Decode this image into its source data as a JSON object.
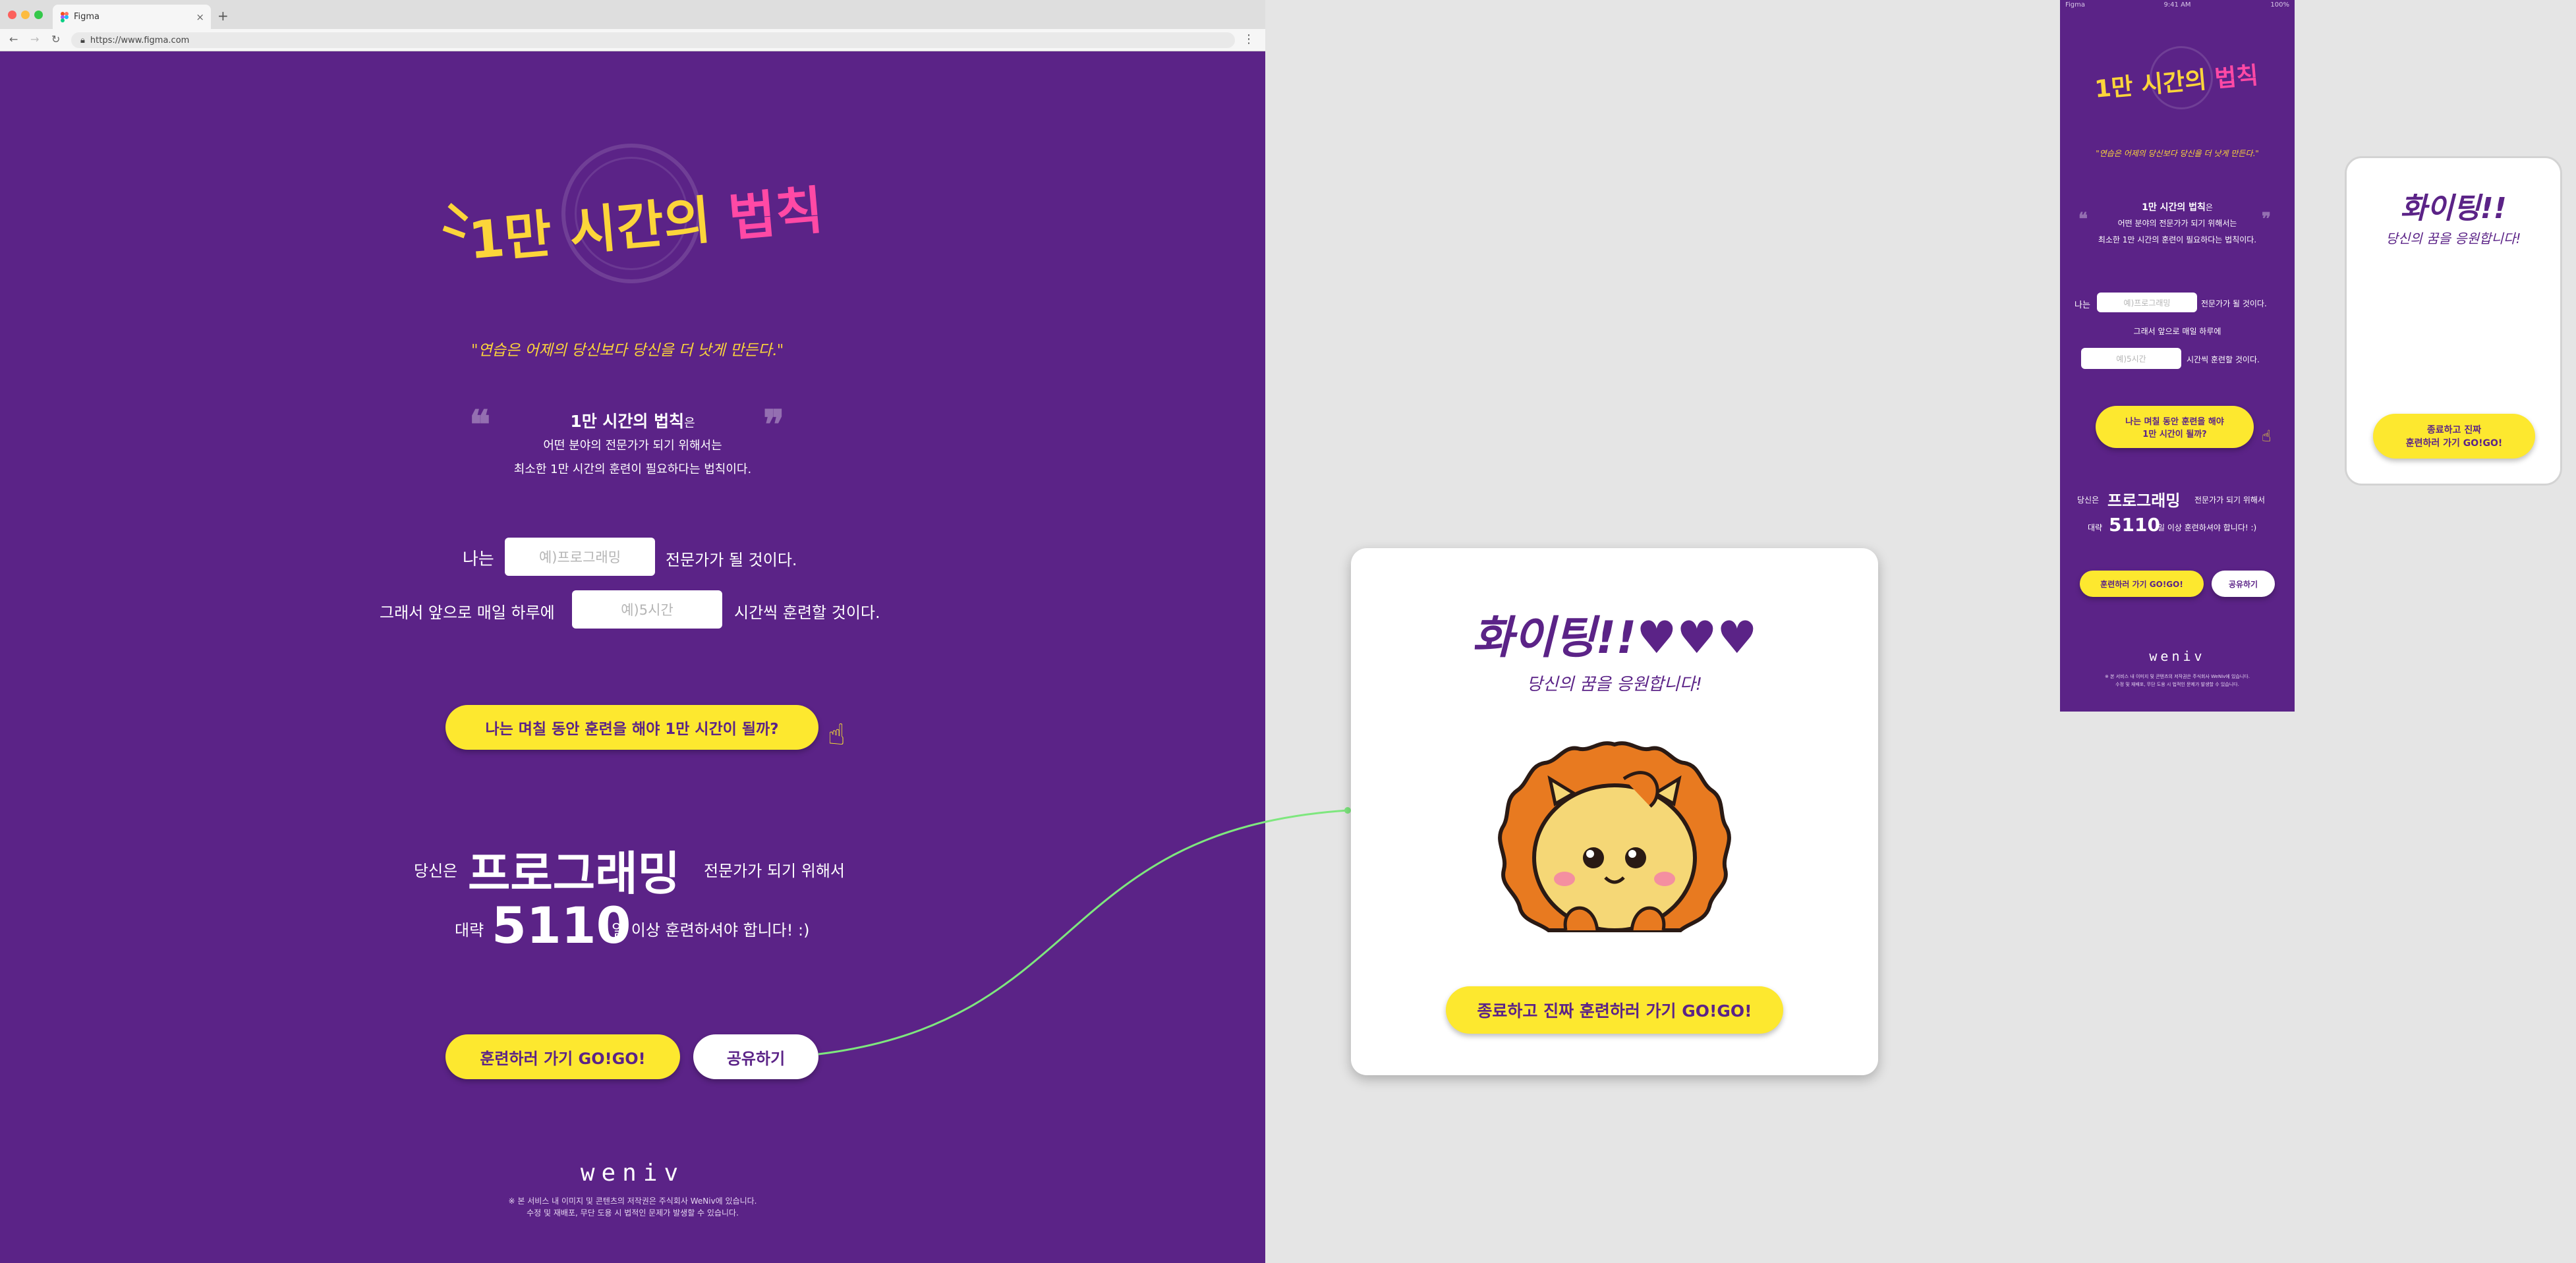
{
  "browser": {
    "tab_title": "Figma",
    "url": "https://www.figma.com",
    "new_tab_icon": "plus-icon",
    "traffic_colors": [
      "#fc605c",
      "#fdbc40",
      "#34c84a"
    ]
  },
  "colors": {
    "brand_purple": "#5b2387",
    "accent_yellow": "#fde82f",
    "logo_yellow": "#fcd53a",
    "logo_pink": "#ff49a5",
    "canvas_gray": "#e5e5e5"
  },
  "main": {
    "logo": {
      "prefix": "1만 시간의 ",
      "highlight": "법칙"
    },
    "tagline": "\"연습은 어제의 당신보다 당신을 더 낫게 만든다.\"",
    "definition": {
      "title": "1만 시간의 법칙",
      "title_suffix": "은",
      "line1": "어떤 분야의 전문가가 되기 위해서는",
      "line2": "최소한 1만 시간의 훈련이 필요하다는 법칙이다.",
      "open_quote": "❝",
      "close_quote": "❞"
    },
    "form": {
      "line1_prefix": "나는",
      "field_placeholder": "예)프로그래밍",
      "line1_suffix": "전문가가 될 것이다.",
      "line2_prefix": "그래서 앞으로 매일 하루에",
      "hours_placeholder": "예)5시간",
      "line2_suffix": "시간씩 훈련할 것이다."
    },
    "cta_label": "나는 며칠 동안 훈련을 해야 1만 시간이 될까?",
    "result": {
      "prefix": "당신은",
      "field": "프로그래밍",
      "suffix": "전문가가 되기 위해서",
      "days_prefix": "대략",
      "days": "5110",
      "days_suffix": "일 이상 훈련하셔야 합니다! :)"
    },
    "go_button": "훈련하러 가기 GO!GO!",
    "share_button": "공유하기",
    "brand": "weniv",
    "footer_line1": "※ 본 서비스 내 이미지 및 콘텐츠의 저작권은 주식회사 WeNiv에 있습니다.",
    "footer_line2": "수정 및 재배포, 무단 도용 시 법적인 문제가 발생할 수 있습니다."
  },
  "modal": {
    "title": "화이팅!!♥♥♥",
    "subtitle": "당신의 꿈을 응원합니다!",
    "close_button": "종료하고 진짜 훈련하러 가기 GO!GO!",
    "image_name": "lion-illustration"
  },
  "mobile": {
    "status_left": "Figma",
    "status_time": "9:41 AM",
    "status_right": "100%",
    "logo": {
      "prefix": "1만 시간의 ",
      "highlight": "법칙"
    },
    "tagline": "\"연습은 어제의 당신보다 당신을 더 낫게 만든다.\"",
    "definition": {
      "title": "1만 시간의 법칙",
      "title_suffix": "은",
      "line1": "어떤 분야의 전문가가 되기 위해서는",
      "line2": "최소한 1만 시간의 훈련이 필요하다는 법칙이다."
    },
    "form": {
      "line1_prefix": "나는",
      "field_placeholder": "예)프로그래밍",
      "line1_suffix": "전문가가 될 것이다.",
      "line2": "그래서 앞으로 매일 하루에",
      "hours_placeholder": "예)5시간",
      "line3_suffix": "시간씩 훈련할 것이다."
    },
    "cta_line1": "나는 며칠 동안 훈련을 해야",
    "cta_line2": "1만 시간이 될까?",
    "result": {
      "prefix": "당신은",
      "field": "프로그래밍",
      "suffix": "전문가가 되기 위해서",
      "days_prefix": "대략",
      "days": "5110",
      "days_suffix": "일 이상 훈련하셔야 합니다! :)"
    },
    "go_button": "훈련하러 가기 GO!GO!",
    "share_button": "공유하기",
    "brand": "weniv",
    "footer_line1": "※ 본 서비스 내 이미지 및 콘텐츠의 저작권은 주식회사 WeNiv에 있습니다.",
    "footer_line2": "수정 및 재배포, 무단 도용 시 법적인 문제가 발생할 수 있습니다."
  },
  "mobile_popup": {
    "title": "화이팅!!",
    "subtitle": "당신의 꿈을 응원합니다!",
    "close_line1": "종료하고 진짜",
    "close_line2": "훈련하러 가기 GO!GO!"
  }
}
